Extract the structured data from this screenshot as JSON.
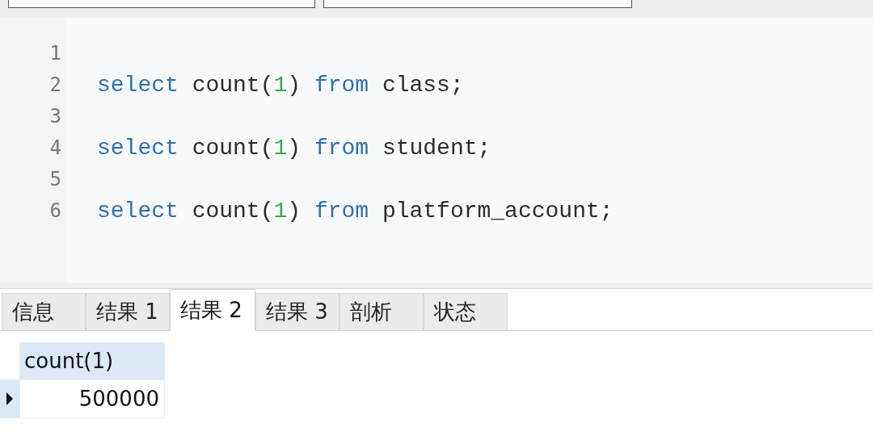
{
  "editor": {
    "lines": [
      {
        "number": "1"
      },
      {
        "number": "2",
        "tokens": [
          {
            "kind": "keyword",
            "text": "select"
          },
          {
            "kind": "plain",
            "text": " count("
          },
          {
            "kind": "number",
            "text": "1"
          },
          {
            "kind": "plain",
            "text": ") "
          },
          {
            "kind": "keyword",
            "text": "from"
          },
          {
            "kind": "plain",
            "text": " class;"
          }
        ]
      },
      {
        "number": "3"
      },
      {
        "number": "4",
        "tokens": [
          {
            "kind": "keyword",
            "text": "select"
          },
          {
            "kind": "plain",
            "text": " count("
          },
          {
            "kind": "number",
            "text": "1"
          },
          {
            "kind": "plain",
            "text": ") "
          },
          {
            "kind": "keyword",
            "text": "from"
          },
          {
            "kind": "plain",
            "text": " student;"
          }
        ]
      },
      {
        "number": "5"
      },
      {
        "number": "6",
        "tokens": [
          {
            "kind": "keyword",
            "text": "select"
          },
          {
            "kind": "plain",
            "text": " count("
          },
          {
            "kind": "number",
            "text": "1"
          },
          {
            "kind": "plain",
            "text": ") "
          },
          {
            "kind": "keyword",
            "text": "from"
          },
          {
            "kind": "plain",
            "text": " platform_account;"
          }
        ]
      }
    ]
  },
  "tabs": [
    {
      "label": "信息",
      "selected": false
    },
    {
      "label": "结果 1",
      "selected": false
    },
    {
      "label": "结果 2",
      "selected": true
    },
    {
      "label": "结果 3",
      "selected": false
    },
    {
      "label": "剖析",
      "selected": false
    },
    {
      "label": "状态",
      "selected": false
    }
  ],
  "table": {
    "columns": [
      "count(1)"
    ],
    "rows": [
      {
        "cells": [
          "500000"
        ],
        "selected": true
      }
    ]
  }
}
